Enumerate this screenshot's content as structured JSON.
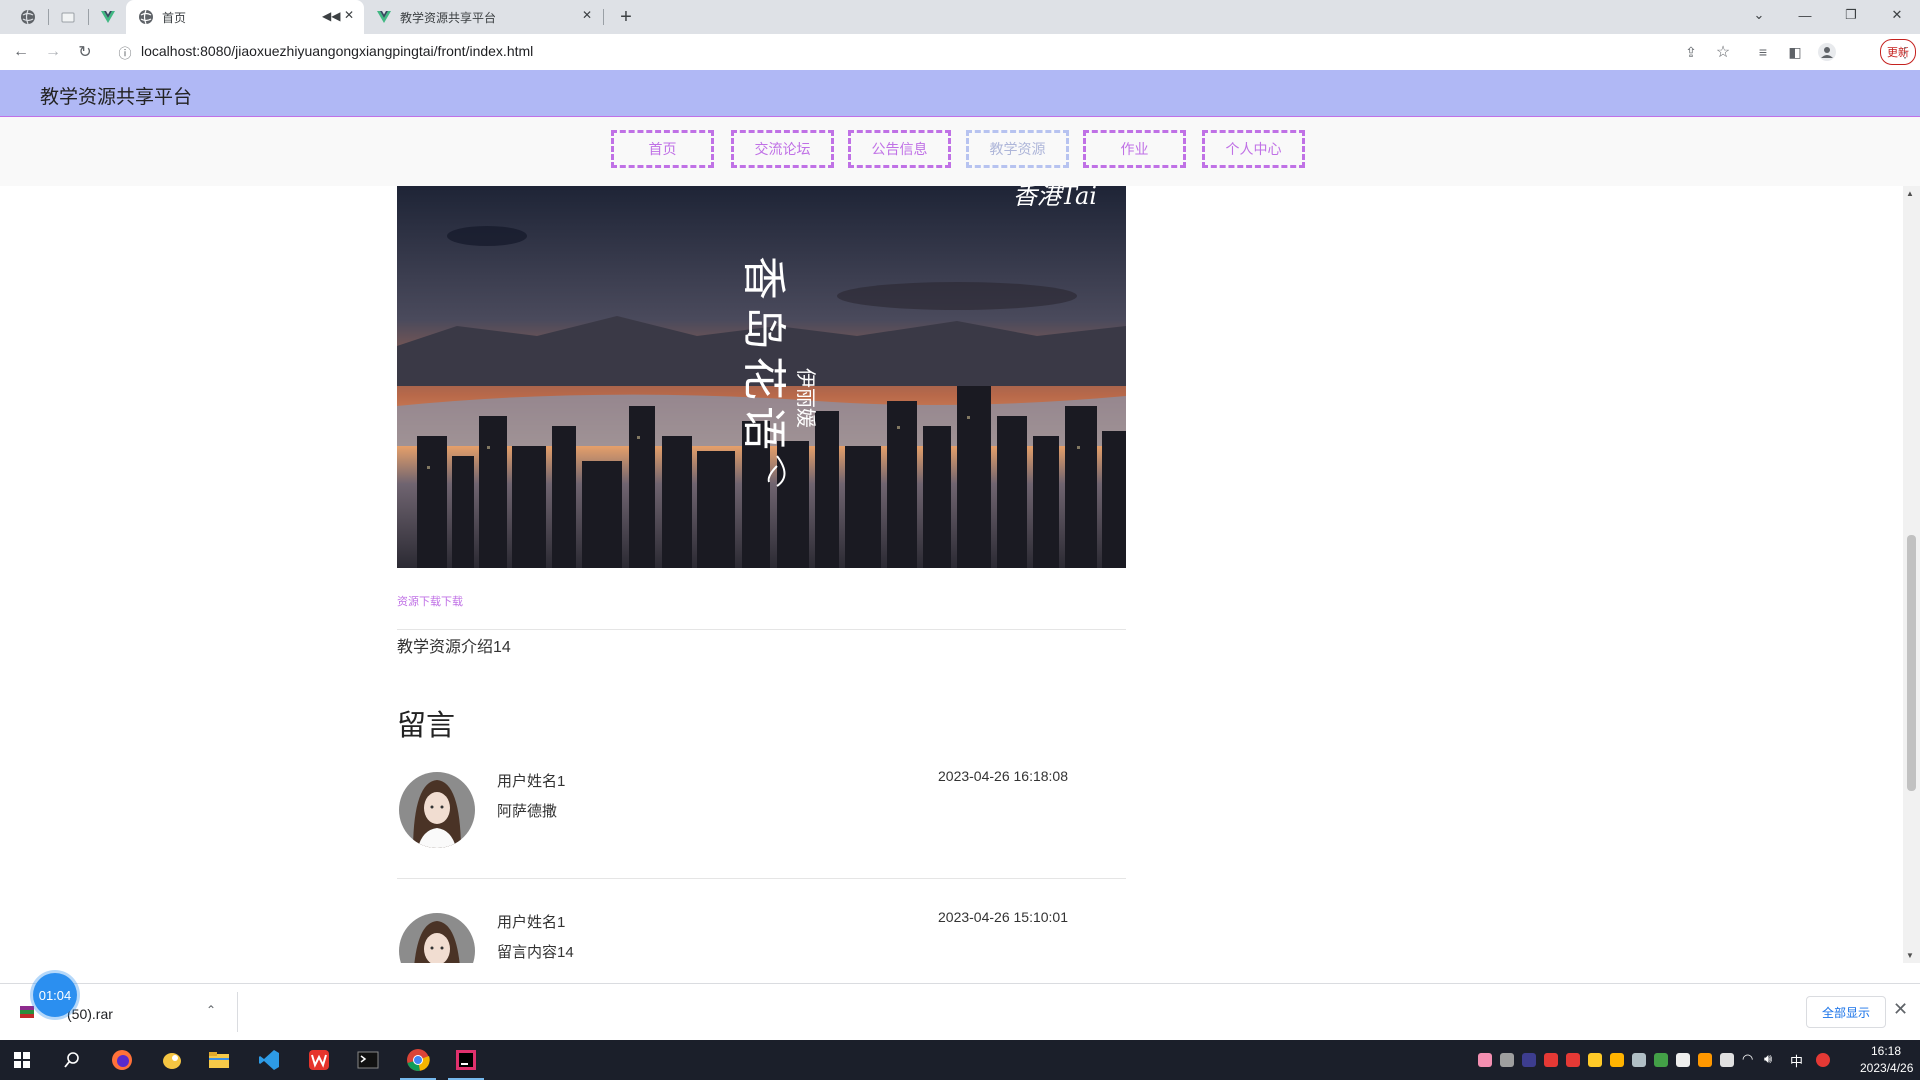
{
  "browser": {
    "tabs": [
      {
        "title": "首页",
        "active": true,
        "muted": true
      },
      {
        "title": "教学资源共享平台",
        "active": false
      }
    ],
    "url": "localhost:8080/jiaoxuezhiyuangongxiangpingtai/front/index.html",
    "update_label": "更新"
  },
  "site": {
    "title": "教学资源共享平台",
    "nav": [
      "首页",
      "交流论坛",
      "公告信息",
      "教学资源",
      "作业",
      "个人中心"
    ],
    "current_nav": "教学资源"
  },
  "resource": {
    "banner_watermark": "香港Tai",
    "banner_title": "香岛花语",
    "banner_artist": "伊丽媛",
    "download_link": "资源下载下载",
    "intro": "教学资源介绍14"
  },
  "comments_section": {
    "title": "留言",
    "items": [
      {
        "user": "用户姓名1",
        "text": "阿萨德撒",
        "time": "2023-04-26 16:18:08"
      },
      {
        "user": "用户姓名1",
        "text": "留言内容14",
        "time": "2023-04-26 15:10:01"
      }
    ]
  },
  "downloads": {
    "file_name": "(50).rar",
    "show_all": "全部显示",
    "timer": "01:04"
  },
  "taskbar": {
    "ime": "中",
    "time": "16:18",
    "date": "2023/4/26"
  },
  "colors": {
    "header_bg": "#b0b8f5",
    "accent": "#c071e6",
    "nav_current": "#aeb6d9"
  }
}
